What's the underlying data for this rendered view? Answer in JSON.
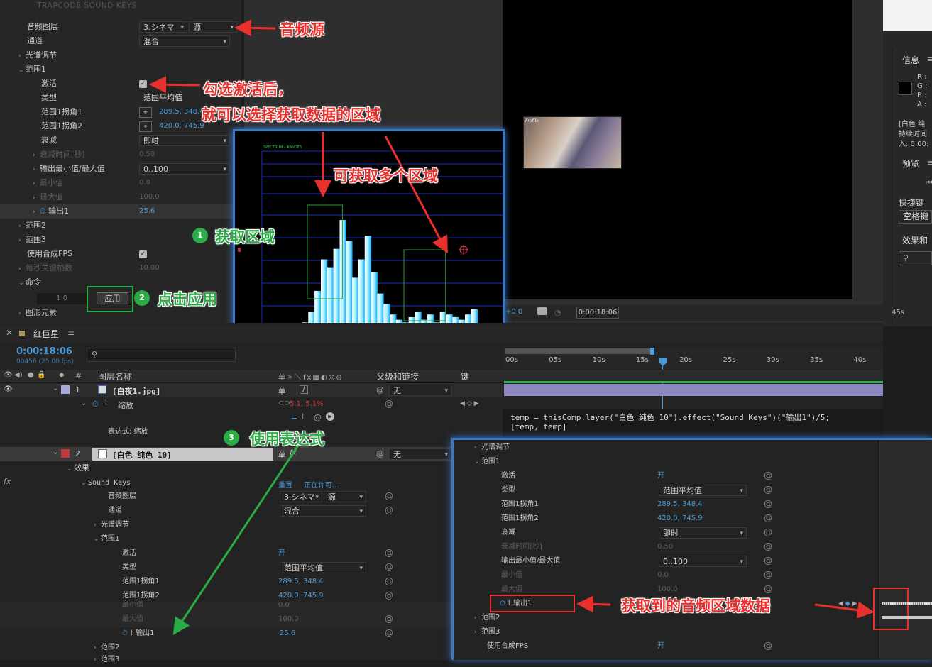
{
  "effect_controls": {
    "title": "TRAPCODE SOUND KEYS",
    "audio_layer_label": "音频图层",
    "audio_layer_value": "3.シネマ",
    "audio_source_value": "源",
    "channel_label": "通道",
    "channel_value": "混合",
    "spectrum_label": "光谱调节",
    "range1_label": "范围1",
    "active_label": "激活",
    "type_label": "类型",
    "type_value": "范围平均值",
    "corner1_label": "范围1拐角1",
    "corner1_value": "289.5, 348.4",
    "corner2_label": "范围1拐角2",
    "corner2_value": "420.0, 745.9",
    "falloff_label": "衰减",
    "falloff_value": "即时",
    "falloff_time_label": "衰减时间[秒]",
    "falloff_time_value": "0.50",
    "output_minmax_label": "输出最小值/最大值",
    "output_minmax_value": "0..100",
    "min_label": "最小值",
    "min_value": "0.0",
    "max_label": "最大值",
    "max_value": "100.0",
    "output1_label": "输出1",
    "output1_value": "25.6",
    "range2_label": "范围2",
    "range3_label": "范围3",
    "use_fps_label": "使用合成FPS",
    "keys_per_sec_label": "每秒关键帧数",
    "keys_per_sec_value": "10.00",
    "command_label": "命令",
    "cmd_left_value": "1 0",
    "apply_button": "应用",
    "graphics_label": "图形元素"
  },
  "viewer": {
    "exposure": "+0.0",
    "timecode": "0:00:18:06",
    "thumb_text": "Frofile"
  },
  "info_panel": {
    "info_title": "信息",
    "r": "R :",
    "g": "G :",
    "b": "B :",
    "a": "A :",
    "layer_line1": "[白色 纯",
    "layer_line2": "持续时间",
    "layer_line3": "入: 0:00:",
    "preview_title": "预览",
    "shortcut_title": "快捷键",
    "shortcut_value": "空格键",
    "effects_title": "效果和",
    "ruler_start": "45s"
  },
  "spectrum": {
    "header_text": "SPECTRUM • RANGES",
    "bars": [
      12,
      18,
      14,
      22,
      30,
      46,
      70,
      64,
      78,
      100,
      84,
      56,
      70,
      88,
      60,
      44,
      36,
      28,
      24,
      22,
      26,
      30,
      24,
      28,
      22,
      30,
      28,
      26,
      24,
      28,
      32,
      20,
      18,
      16,
      14
    ],
    "box1": {
      "from": 0.11,
      "to": 0.27
    },
    "box2": {
      "from": 0.55,
      "to": 0.74
    }
  },
  "timeline": {
    "comp_name": "红巨星",
    "timecode": "0:00:18:06",
    "frames": "00456 (25.00 fps)",
    "col_layer_name": "图层名称",
    "col_parent": "父级和链接",
    "col_keys": "键",
    "col_num": "#",
    "layer1_num": "1",
    "layer1_name": "[白夜1.jpg]",
    "layer1_parent": "无",
    "scale_label": "缩放",
    "scale_value": "5.1, 5.1%",
    "expr_label": "表达式: 缩放",
    "layer2_num": "2",
    "layer2_name": "[白色 纯色 10]",
    "layer2_parent": "无",
    "effects_label": "效果",
    "sk_label": "Sound Keys",
    "reset_label": "重置",
    "licensing_label": "正在许可...",
    "audio_layer_label": "音频图层",
    "audio_layer_value": "3.シネマ",
    "audio_source_value": "源",
    "channel_label": "通道",
    "channel_value": "混合",
    "spectrum_label": "光谱调节",
    "range1_label": "范围1",
    "active_label": "激活",
    "active_value": "开",
    "type_label": "类型",
    "type_value": "范围平均值",
    "corner1_label": "范围1拐角1",
    "corner1_value": "289.5, 348.4",
    "corner2_label": "范围1拐角2",
    "corner2_value": "420.0, 745.9",
    "min_label": "最小值",
    "min_value": "0.0",
    "max_label": "最大值",
    "max_value": "100.0",
    "output1_label": "输出1",
    "output1_value": "25.6",
    "range2_label": "范围2",
    "range3_label": "范围3",
    "ruler_ticks": [
      "00s",
      "05s",
      "10s",
      "15s",
      "20s",
      "25s",
      "30s",
      "35s",
      "40s"
    ],
    "expression_line1": "temp = thisComp.layer(\"白色 纯色 10\").effect(\"Sound Keys\")(\"输出1\")/5;",
    "expression_line2": "[temp, temp]"
  },
  "zoom_panel": {
    "spectrum_label": "光谱调节",
    "range1_label": "范围1",
    "active_label": "激活",
    "active_value": "开",
    "type_label": "类型",
    "type_value": "范围平均值",
    "corner1_label": "范围1拐角1",
    "corner1_value": "289.5, 348.4",
    "corner2_label": "范围1拐角2",
    "corner2_value": "420.0, 745.9",
    "falloff_label": "衰减",
    "falloff_value": "即时",
    "falloff_time_label": "衰减时间[秒]",
    "falloff_time_value": "0.50",
    "output_minmax_label": "输出最小值/最大值",
    "output_minmax_value": "0..100",
    "min_label": "最小值",
    "min_value": "0.0",
    "max_label": "最大值",
    "max_value": "100.0",
    "output1_label": "输出1",
    "range2_label": "范围2",
    "range3_label": "范围3",
    "use_fps_label": "使用合成FPS",
    "use_fps_value": "开"
  },
  "annotations": {
    "audio_source": "音频源",
    "check_after_line1": "勾选激活后，",
    "check_after_line2": "就可以选择获取数据的区域",
    "multi_region": "可获取多个区域",
    "get_region": "获取区域",
    "click_apply": "点击应用",
    "use_expression": "使用表达式",
    "got_data": "获取到的音频区域数据",
    "badge1": "1",
    "badge2": "2",
    "badge3": "3"
  },
  "colors": {
    "accent_blue": "#4a9bd8",
    "callout_red": "#e8302d",
    "callout_green": "#2bab45",
    "layer1_label": "#a5a8d8",
    "layer2_label": "#c2393b"
  }
}
